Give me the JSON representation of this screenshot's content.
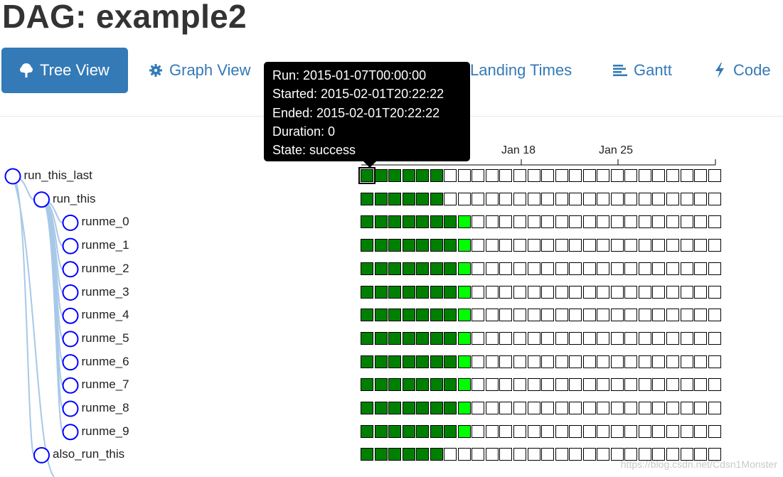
{
  "page": {
    "title": "DAG: example2"
  },
  "nav": {
    "tree_view": "Tree View",
    "graph_view": "Graph View",
    "landing_times": "Landing Times",
    "gantt": "Gantt",
    "code": "Code"
  },
  "tooltip": {
    "run": "Run: 2015-01-07T00:00:00",
    "started": "Started: 2015-02-01T20:22:22",
    "ended": "Ended: 2015-02-01T20:22:22",
    "duration": "Duration: 0",
    "state": "State: success"
  },
  "axis": {
    "ticks": [
      "Jan 18",
      "Jan 25"
    ]
  },
  "tasks": [
    {
      "label": "run_this_last",
      "depth": 0,
      "states": "ssssss",
      "selected_index": 0
    },
    {
      "label": "run_this",
      "depth": 1,
      "states": "ssssss"
    },
    {
      "label": "runme_0",
      "depth": 2,
      "states": "sssssssr"
    },
    {
      "label": "runme_1",
      "depth": 2,
      "states": "sssssssr"
    },
    {
      "label": "runme_2",
      "depth": 2,
      "states": "sssssssr"
    },
    {
      "label": "runme_3",
      "depth": 2,
      "states": "sssssssr"
    },
    {
      "label": "runme_4",
      "depth": 2,
      "states": "sssssssr"
    },
    {
      "label": "runme_5",
      "depth": 2,
      "states": "sssssssr"
    },
    {
      "label": "runme_6",
      "depth": 2,
      "states": "sssssssr"
    },
    {
      "label": "runme_7",
      "depth": 2,
      "states": "sssssssr"
    },
    {
      "label": "runme_8",
      "depth": 2,
      "states": "sssssssr"
    },
    {
      "label": "runme_9",
      "depth": 2,
      "states": "sssssssr"
    },
    {
      "label": "also_run_this",
      "depth": 1,
      "states": "ssssss"
    }
  ],
  "grid": {
    "columns": 26
  },
  "colors": {
    "success": "#008000",
    "running": "#00ff00",
    "node_stroke": "#0000ff",
    "link": "#a8c8e8",
    "accent": "#337ab7"
  },
  "watermark": "https://blog.csdn.net/Cdsn1Monster"
}
